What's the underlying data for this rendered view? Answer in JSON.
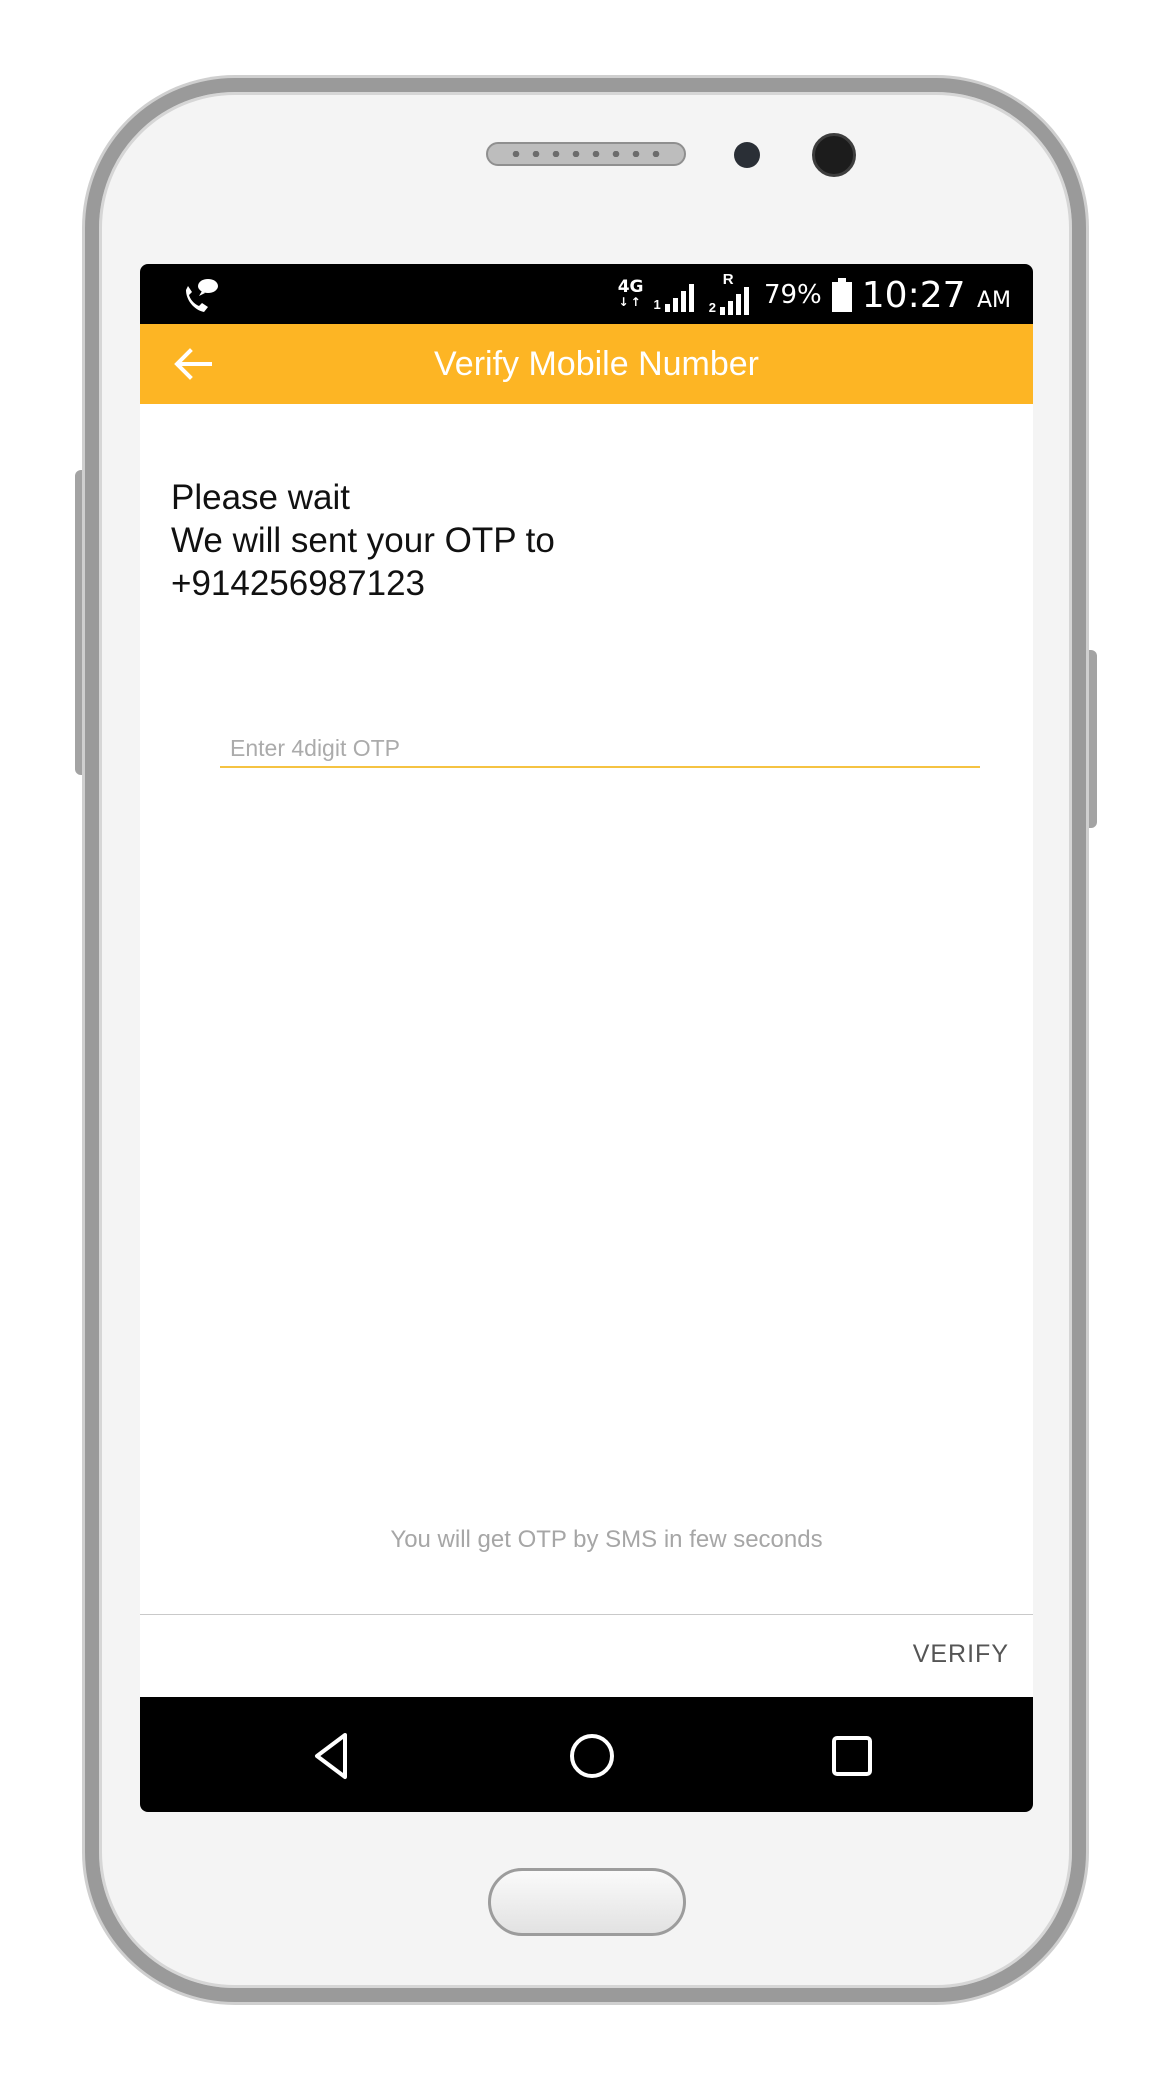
{
  "status_bar": {
    "network_type": "4G",
    "sim1_label": "1",
    "sim2_label": "2",
    "roaming_label": "R",
    "battery_percent": "79%",
    "time": "10:27",
    "time_period": "AM"
  },
  "app_bar": {
    "title": "Verify Mobile Number",
    "back_icon": "arrow-left-icon"
  },
  "content": {
    "message_lines": [
      "Please wait",
      "We will sent your OTP to",
      "+914256987123"
    ],
    "otp_input": {
      "value": "",
      "placeholder": "Enter 4digit OTP"
    },
    "hint": "You will get OTP by SMS in few seconds"
  },
  "footer": {
    "verify_label": "VERIFY"
  },
  "nav_bar": {
    "icons": [
      "back-triangle-icon",
      "home-circle-icon",
      "recents-square-icon"
    ]
  },
  "colors": {
    "accent": "#fdb524",
    "status_bar": "#000000",
    "underline": "#f5c342"
  }
}
